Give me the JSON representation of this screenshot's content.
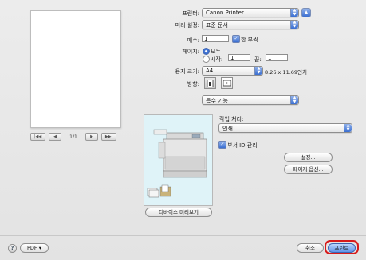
{
  "preview": {
    "page_counter": "1/1"
  },
  "form": {
    "printer_label": "프린터:",
    "printer_value": "Canon Printer",
    "presets_label": "미리 설정:",
    "presets_value": "표준 문서",
    "copies_label": "매수:",
    "copies_value": "1",
    "two_sided_label": "한 부씩",
    "pages_label": "페이지:",
    "pages_all_label": "모두",
    "pages_from_label": "시작:",
    "pages_from_value": "1",
    "pages_to_label": "끝:",
    "pages_to_value": "1",
    "paper_size_label": "용지 크기:",
    "paper_size_value": "A4",
    "paper_size_dims": "8.26 x 11.69인치",
    "orientation_label": "방향:",
    "section_value": "특수 기능"
  },
  "special": {
    "job_processing_label": "작업 처리:",
    "job_processing_value": "인쇄",
    "secure_id_label": "부서 ID 관리",
    "settings_button": "설정...",
    "page_options_button": "페이지 옵션...",
    "device_preview_button": "디바이스 미리보기"
  },
  "footer": {
    "help_icon_glyph": "?",
    "pdf_button": "PDF ▾",
    "cancel_button": "취소",
    "print_button": "프린트"
  },
  "colors": {
    "accent": "#3b6fd1",
    "highlight_ring": "#d81b1b"
  }
}
